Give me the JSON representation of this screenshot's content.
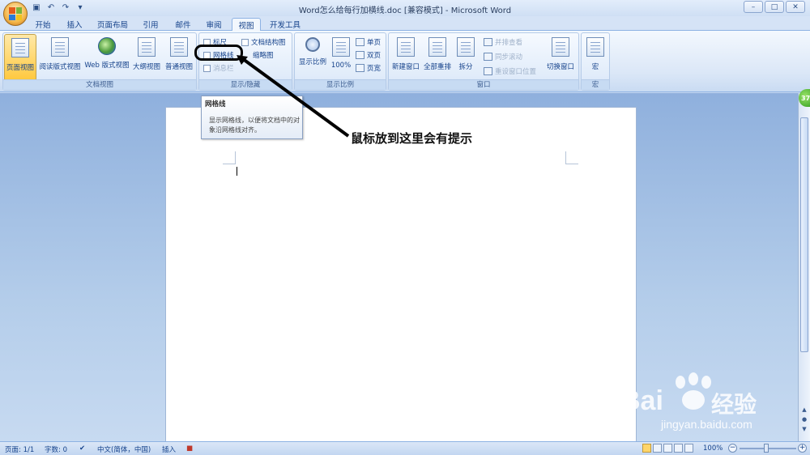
{
  "window": {
    "title": "Word怎么给每行加横线.doc [兼容模式] - Microsoft Word",
    "controls": [
      "–",
      "□",
      "✕"
    ]
  },
  "tabs": [
    {
      "label": "开始"
    },
    {
      "label": "插入"
    },
    {
      "label": "页面布局"
    },
    {
      "label": "引用"
    },
    {
      "label": "邮件"
    },
    {
      "label": "审阅"
    },
    {
      "label": "视图"
    },
    {
      "label": "开发工具"
    }
  ],
  "ribbon": {
    "doc_views": {
      "label": "文档视图",
      "buttons": [
        "页面视图",
        "阅读版式视图",
        "Web 版式视图",
        "大纲视图",
        "普通视图"
      ]
    },
    "show_hide": {
      "label": "显示/隐藏",
      "items": [
        "标尺",
        "文档结构图",
        "网格线",
        "缩略图",
        "消息栏"
      ]
    },
    "zoom": {
      "label": "显示比例",
      "zoom_btn": "显示比例",
      "percent_btn": "100%",
      "one_page": "单页",
      "two_pages": "双页",
      "page_width": "页宽"
    },
    "window": {
      "label": "窗口",
      "new_window": "新建窗口",
      "arrange_all": "全部重排",
      "split": "拆分",
      "side_by_side": "并排查看",
      "sync_scroll": "同步滚动",
      "reset_pos": "重设窗口位置",
      "switch_windows": "切换窗口"
    },
    "macros": {
      "label": "宏",
      "button": "宏"
    }
  },
  "tooltip": {
    "title": "网格线",
    "body": "显示网格线，以便将文档中的对象沿网格线对齐。"
  },
  "annotation": {
    "text": "鼠标放到这里会有提示"
  },
  "badge": "37",
  "watermark": {
    "brand": "Bai",
    "brand2": "经验",
    "url": "jingyan.baidu.com"
  },
  "status": {
    "page": "页面: 1/1",
    "words": "字数: 0",
    "language": "中文(简体，中国)",
    "mode": "插入",
    "zoom": "100%"
  }
}
